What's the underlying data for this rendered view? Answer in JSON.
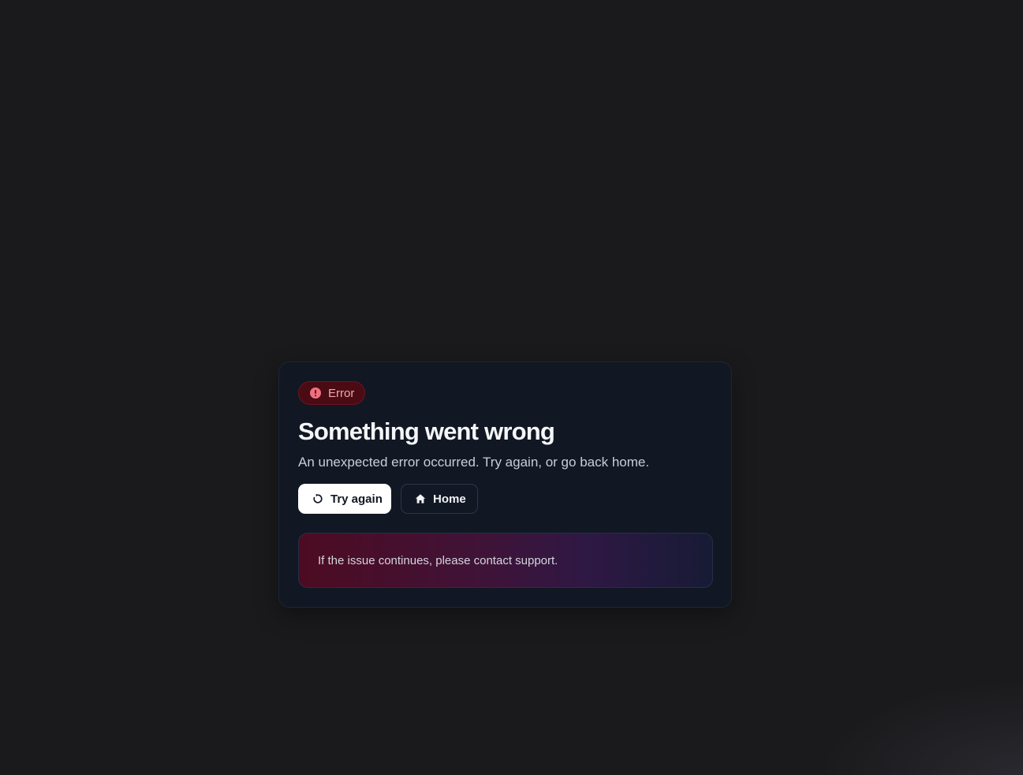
{
  "colors": {
    "page_background": "#1a1a1c",
    "card_background": "#111723",
    "badge_background": "#4a0b14",
    "badge_text": "#f3a7ae",
    "error_icon": "#f0717c"
  },
  "error_card": {
    "badge": {
      "icon": "alert-circle-icon",
      "label": "Error"
    },
    "title": "Something went wrong",
    "message": "An unexpected error occurred. Try again, or go back home.",
    "actions": {
      "retry": {
        "icon": "refresh-icon",
        "label": "Try again"
      },
      "home": {
        "icon": "home-icon",
        "label": "Home"
      }
    },
    "notice": {
      "text": "If the issue continues, please contact support."
    }
  }
}
